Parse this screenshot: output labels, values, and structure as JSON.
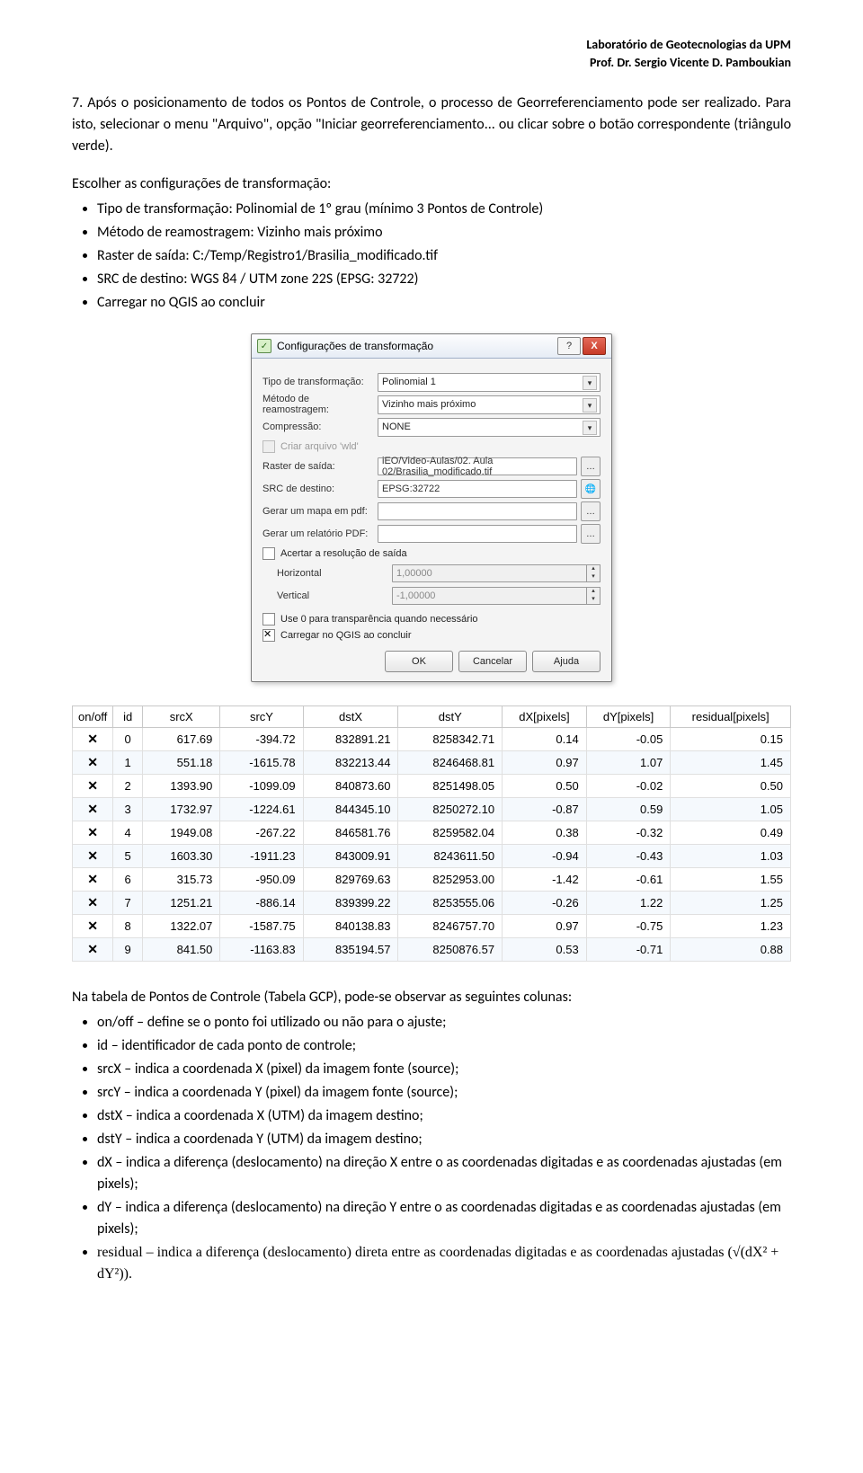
{
  "header": {
    "line1": "Laboratório de Geotecnologias da UPM",
    "line2": "Prof. Dr. Sergio Vicente D. Pamboukian"
  },
  "intro": "7. Após o posicionamento de todos os Pontos de Controle, o processo de Georreferenciamento pode ser realizado. Para isto, selecionar o menu \"Arquivo\", opção \"Iniciar georreferenciamento... ou clicar sobre o botão correspondente (triângulo verde).",
  "config_intro": "Escolher as configurações de transformação:",
  "config_bullets": [
    "Tipo de transformação: Polinomial de 1º grau (mínimo 3 Pontos de Controle)",
    "Método de reamostragem: Vizinho mais próximo",
    "Raster de saída: C:/Temp/Registro1/Brasilia_modificado.tif",
    "SRC de destino: WGS 84 / UTM zone 22S (EPSG: 32722)",
    "Carregar no QGIS ao concluir"
  ],
  "dialog": {
    "title": "Configurações de transformação",
    "rows": {
      "tipo_label": "Tipo de transformação:",
      "tipo_value": "Polinomial 1",
      "metodo_label": "Método de reamostragem:",
      "metodo_value": "Vizinho mais próximo",
      "compress_label": "Compressão:",
      "compress_value": "NONE",
      "chk_wld": "Criar arquivo 'wld'",
      "raster_label": "Raster de saída:",
      "raster_value": "iEO/Video-Aulas/02. Aula 02/Brasilia_modificado.tif",
      "src_label": "SRC de destino:",
      "src_value": "EPSG:32722",
      "mapa_label": "Gerar um mapa em pdf:",
      "relatorio_label": "Gerar um relatório PDF:",
      "chk_res": "Acertar a resolução de saída",
      "horiz_label": "Horizontal",
      "horiz_value": "1,00000",
      "vert_label": "Vertical",
      "vert_value": "-1,00000",
      "chk_zero": "Use 0 para transparência quando necessário",
      "chk_load": "Carregar no QGIS ao concluir",
      "ok": "OK",
      "cancel": "Cancelar",
      "help": "Ajuda"
    }
  },
  "gcp_headers": [
    "on/off",
    "id",
    "srcX",
    "srcY",
    "dstX",
    "dstY",
    "dX[pixels]",
    "dY[pixels]",
    "residual[pixels]"
  ],
  "gcp_rows": [
    {
      "id": "0",
      "srcX": "617.69",
      "srcY": "-394.72",
      "dstX": "832891.21",
      "dstY": "8258342.71",
      "dX": "0.14",
      "dY": "-0.05",
      "res": "0.15"
    },
    {
      "id": "1",
      "srcX": "551.18",
      "srcY": "-1615.78",
      "dstX": "832213.44",
      "dstY": "8246468.81",
      "dX": "0.97",
      "dY": "1.07",
      "res": "1.45"
    },
    {
      "id": "2",
      "srcX": "1393.90",
      "srcY": "-1099.09",
      "dstX": "840873.60",
      "dstY": "8251498.05",
      "dX": "0.50",
      "dY": "-0.02",
      "res": "0.50"
    },
    {
      "id": "3",
      "srcX": "1732.97",
      "srcY": "-1224.61",
      "dstX": "844345.10",
      "dstY": "8250272.10",
      "dX": "-0.87",
      "dY": "0.59",
      "res": "1.05"
    },
    {
      "id": "4",
      "srcX": "1949.08",
      "srcY": "-267.22",
      "dstX": "846581.76",
      "dstY": "8259582.04",
      "dX": "0.38",
      "dY": "-0.32",
      "res": "0.49"
    },
    {
      "id": "5",
      "srcX": "1603.30",
      "srcY": "-1911.23",
      "dstX": "843009.91",
      "dstY": "8243611.50",
      "dX": "-0.94",
      "dY": "-0.43",
      "res": "1.03"
    },
    {
      "id": "6",
      "srcX": "315.73",
      "srcY": "-950.09",
      "dstX": "829769.63",
      "dstY": "8252953.00",
      "dX": "-1.42",
      "dY": "-0.61",
      "res": "1.55"
    },
    {
      "id": "7",
      "srcX": "1251.21",
      "srcY": "-886.14",
      "dstX": "839399.22",
      "dstY": "8253555.06",
      "dX": "-0.26",
      "dY": "1.22",
      "res": "1.25"
    },
    {
      "id": "8",
      "srcX": "1322.07",
      "srcY": "-1587.75",
      "dstX": "840138.83",
      "dstY": "8246757.70",
      "dX": "0.97",
      "dY": "-0.75",
      "res": "1.23"
    },
    {
      "id": "9",
      "srcX": "841.50",
      "srcY": "-1163.83",
      "dstX": "835194.57",
      "dstY": "8250876.57",
      "dX": "0.53",
      "dY": "-0.71",
      "res": "0.88"
    }
  ],
  "after_table_intro": "Na tabela de Pontos de Controle (Tabela GCP), pode-se observar as seguintes colunas:",
  "after_bullets": [
    "on/off – define se o ponto foi utilizado ou não para o ajuste;",
    "id – identificador de cada ponto de controle;",
    "srcX – indica a coordenada X (pixel) da imagem fonte (source);",
    "srcY – indica a coordenada Y (pixel) da imagem fonte (source);",
    "dstX – indica a coordenada X (UTM) da imagem destino;",
    "dstY – indica a coordenada Y (UTM) da imagem destino;",
    "dX – indica a diferença (deslocamento) na direção X entre o as coordenadas digitadas e as coordenadas ajustadas (em pixels);",
    "dY – indica a diferença (deslocamento) na direção Y entre o as coordenadas digitadas e as coordenadas ajustadas (em pixels);",
    "residual – indica a diferença (deslocamento) direta entre as coordenadas digitadas e as coordenadas ajustadas (√(dX² + dY²))."
  ]
}
